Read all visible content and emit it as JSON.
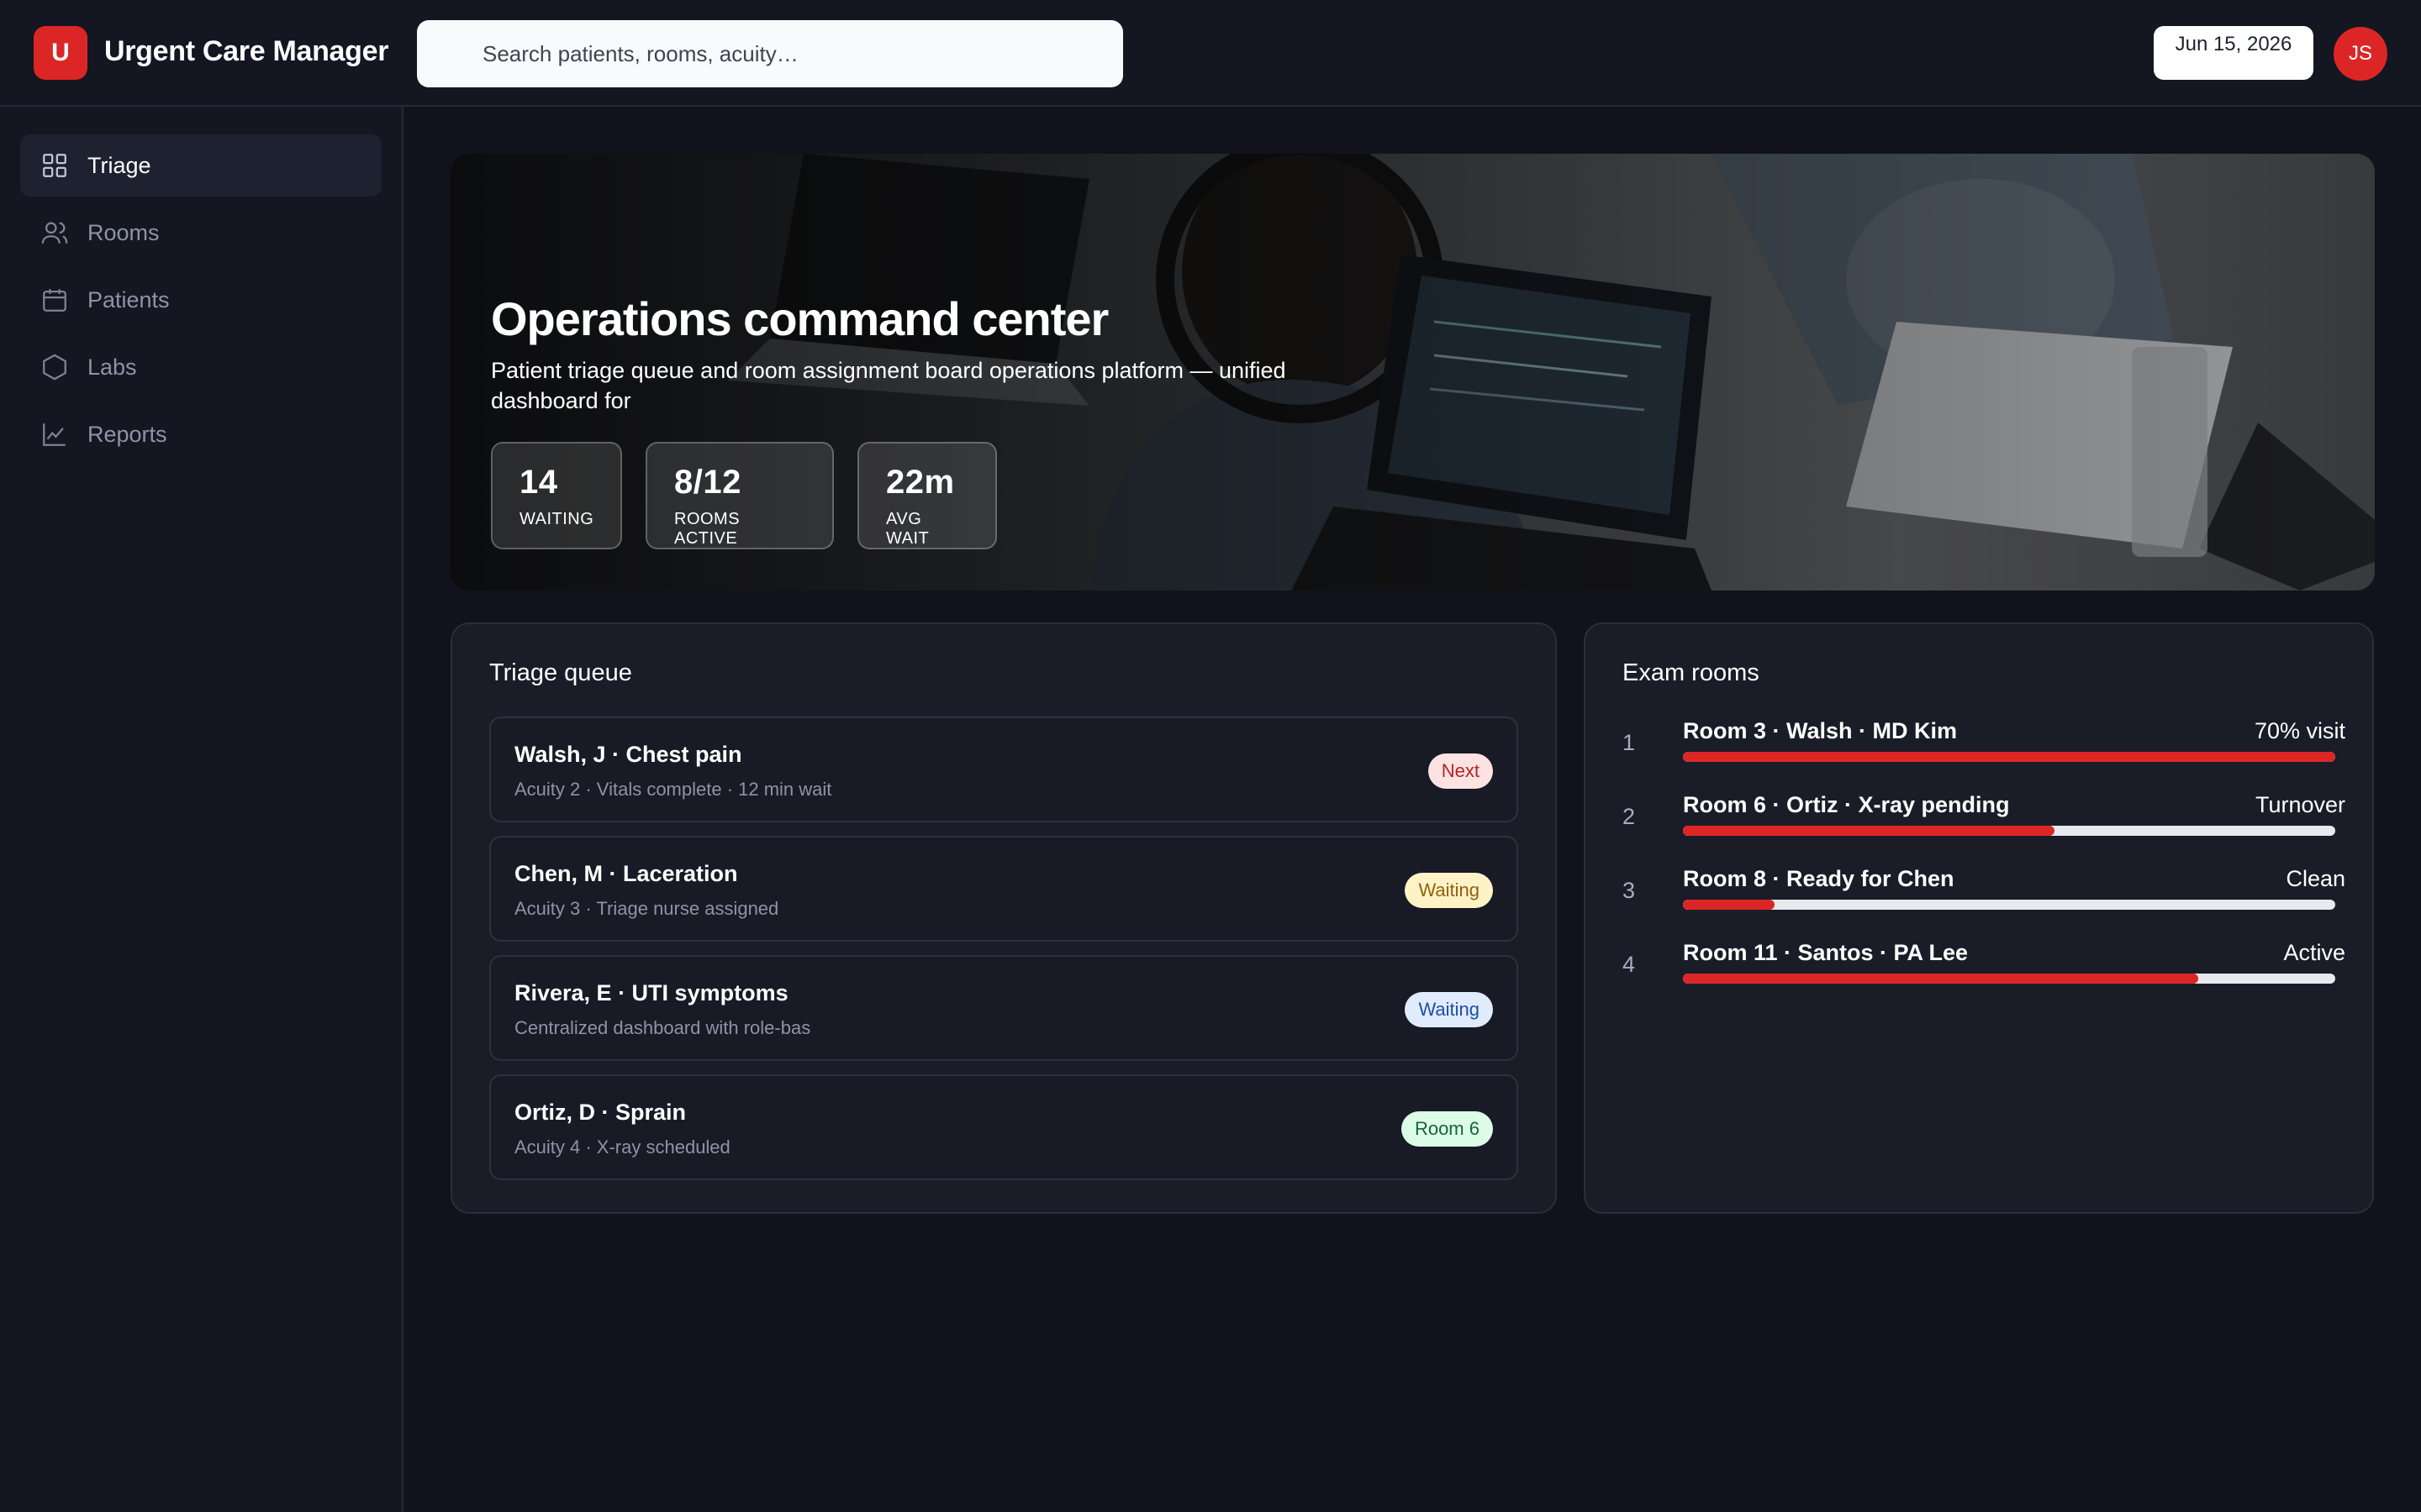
{
  "app": {
    "logo_letter": "U",
    "title": "Urgent Care Manager"
  },
  "search": {
    "placeholder": "Search patients, rooms, acuity…"
  },
  "header": {
    "date": "Jun 15, 2026",
    "avatar_initials": "JS"
  },
  "sidebar": {
    "items": [
      {
        "label": "Triage",
        "icon": "grid-icon",
        "active": true
      },
      {
        "label": "Rooms",
        "icon": "users-icon",
        "active": false
      },
      {
        "label": "Patients",
        "icon": "calendar-icon",
        "active": false
      },
      {
        "label": "Labs",
        "icon": "hexagon-icon",
        "active": false
      },
      {
        "label": "Reports",
        "icon": "chart-line-icon",
        "active": false
      }
    ]
  },
  "hero": {
    "title": "Operations command center",
    "subtitle": "Patient triage queue and room assignment board operations platform — unified dashboard for",
    "stats": [
      {
        "value": "14",
        "label": "WAITING"
      },
      {
        "value": "8/12",
        "label": "ROOMS ACTIVE"
      },
      {
        "value": "22m",
        "label": "AVG WAIT"
      }
    ]
  },
  "triage": {
    "title": "Triage queue",
    "items": [
      {
        "name": "Walsh, J · Chest pain",
        "meta": "Acuity 2 · Vitals complete · 12 min wait",
        "badge": "Next",
        "badge_bg": "#fde2e2",
        "badge_fg": "#b42323"
      },
      {
        "name": "Chen, M · Laceration",
        "meta": "Acuity 3 · Triage nurse assigned",
        "badge": "Waiting",
        "badge_bg": "#fef3c7",
        "badge_fg": "#92600e"
      },
      {
        "name": "Rivera, E · UTI symptoms",
        "meta": "Centralized dashboard with role-bas",
        "badge": "Waiting",
        "badge_bg": "#e0ecfd",
        "badge_fg": "#1e4fa3"
      },
      {
        "name": "Ortiz, D · Sprain",
        "meta": "Acuity 4 · X-ray scheduled",
        "badge": "Room 6",
        "badge_bg": "#dcfce7",
        "badge_fg": "#166534"
      }
    ]
  },
  "rooms": {
    "title": "Exam rooms",
    "items": [
      {
        "num": "1",
        "label": "Room 3 · Walsh · MD Kim",
        "status": "70% visit",
        "progress": 1.0
      },
      {
        "num": "2",
        "label": "Room 6 · Ortiz · X-ray pending",
        "status": "Turnover",
        "progress": 0.57
      },
      {
        "num": "3",
        "label": "Room 8 · Ready for Chen",
        "status": "Clean",
        "progress": 0.14
      },
      {
        "num": "4",
        "label": "Room 11 · Santos · PA Lee",
        "status": "Active",
        "progress": 0.79
      }
    ]
  },
  "colors": {
    "accent": "#dc2626",
    "background": "#11121b",
    "panel": "#1a1c28"
  }
}
